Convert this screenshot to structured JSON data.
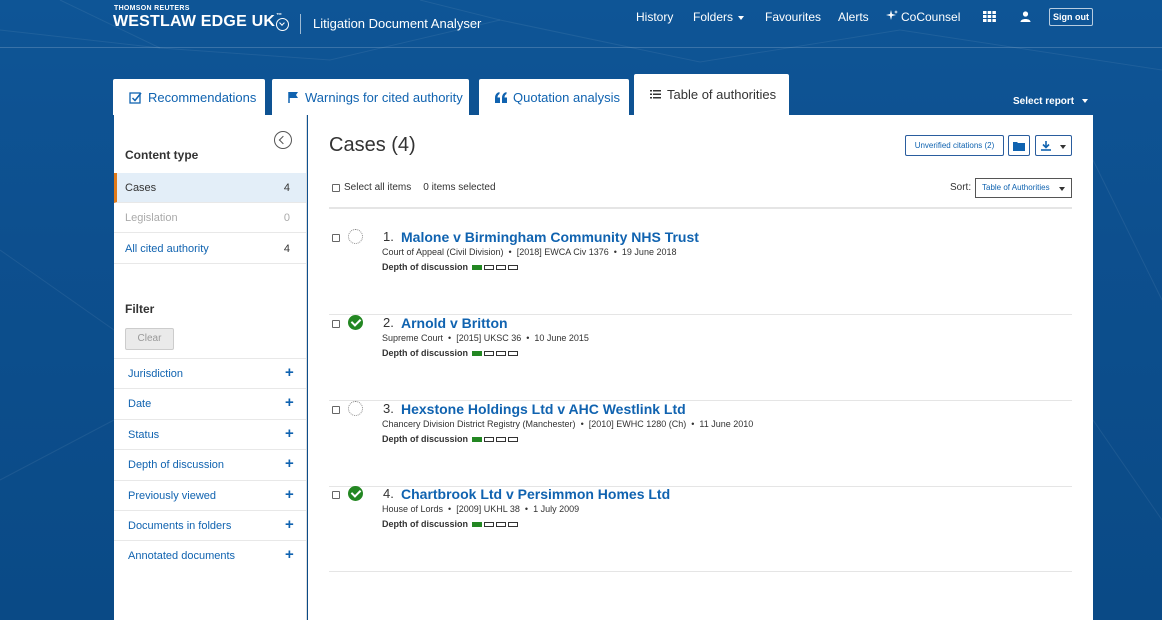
{
  "header": {
    "brand_small": "THOMSON REUTERS",
    "brand_name": "WESTLAW EDGE UK",
    "brand_tm": "™",
    "product": "Litigation Document Analyser",
    "nav": {
      "history": "History",
      "folders": "Folders",
      "favourites": "Favourites",
      "alerts": "Alerts",
      "cocounsel": "CoCounsel"
    },
    "sign_out": "Sign out"
  },
  "tabs": [
    {
      "label": "Recommendations"
    },
    {
      "label": "Warnings for cited authority"
    },
    {
      "label": "Quotation analysis"
    },
    {
      "label": "Table of authorities"
    }
  ],
  "select_report": "Select report",
  "sidebar": {
    "content_type_heading": "Content type",
    "content_types": [
      {
        "label": "Cases",
        "count": "4"
      },
      {
        "label": "Legislation",
        "count": "0"
      },
      {
        "label": "All cited authority",
        "count": "4"
      }
    ],
    "filter_heading": "Filter",
    "clear_label": "Clear",
    "filters": [
      {
        "label": "Jurisdiction"
      },
      {
        "label": "Date"
      },
      {
        "label": "Status"
      },
      {
        "label": "Depth of discussion"
      },
      {
        "label": "Previously viewed"
      },
      {
        "label": "Documents in folders"
      },
      {
        "label": "Annotated documents"
      }
    ],
    "plus": "+"
  },
  "main": {
    "title": "Cases (4)",
    "unverified_label": "Unverified citations (2)",
    "select_all_label": "Select all items",
    "items_selected": "0 items selected",
    "sort_label": "Sort:",
    "sort_value": "Table of Authorities",
    "depth_label": "Depth of discussion",
    "results": [
      {
        "number": "1.",
        "title": "Malone v Birmingham Community NHS Trust",
        "court": "Court of Appeal (Civil Division)",
        "citation": "[2018] EWCA Civ 1376",
        "date": "19 June 2018",
        "status": "unverified",
        "depth": 1
      },
      {
        "number": "2.",
        "title": "Arnold v Britton",
        "court": "Supreme Court",
        "citation": "[2015] UKSC 36",
        "date": "10 June 2015",
        "status": "verified",
        "depth": 1
      },
      {
        "number": "3.",
        "title": "Hexstone Holdings Ltd v AHC Westlink Ltd",
        "court": "Chancery Division District Registry (Manchester)",
        "citation": "[2010] EWHC 1280 (Ch)",
        "date": "11 June 2010",
        "status": "unverified",
        "depth": 1
      },
      {
        "number": "4.",
        "title": "Chartbrook Ltd v Persimmon Homes Ltd",
        "court": "House of Lords",
        "citation": "[2009] UKHL 38",
        "date": "1 July 2009",
        "status": "verified",
        "depth": 1
      }
    ],
    "dot": "•"
  },
  "colors": {
    "background": "#0d4f8e",
    "link": "#1063b0",
    "selected_accent": "#e07a1a",
    "verified_green": "#238722"
  }
}
